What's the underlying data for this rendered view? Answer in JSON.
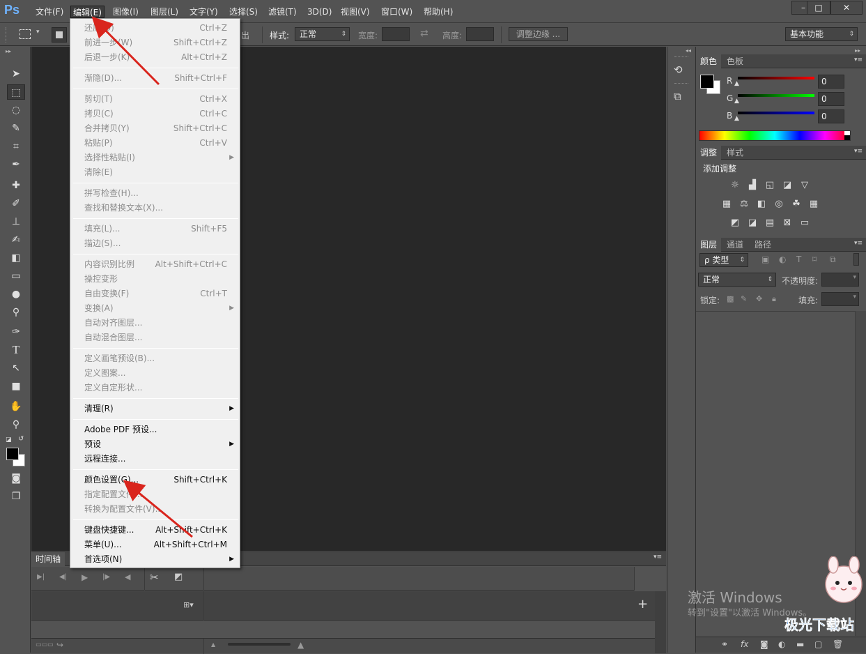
{
  "app": {
    "logo": "Ps"
  },
  "menubar": {
    "items": [
      "文件(F)",
      "编辑(E)",
      "图像(I)",
      "图层(L)",
      "文字(Y)",
      "选择(S)",
      "滤镜(T)",
      "3D(D)",
      "视图(V)",
      "窗口(W)",
      "帮助(H)"
    ],
    "window_buttons": [
      "–",
      "□",
      "✕"
    ]
  },
  "options": {
    "partial_label": "出",
    "style_label": "样式:",
    "style_value": "正常",
    "width_label": "宽度:",
    "height_label": "高度:",
    "refine_label": "调整边缘 ...",
    "workspace_value": "基本功能"
  },
  "edit_menu": {
    "items": [
      {
        "label": "还原(O)",
        "shortcut": "Ctrl+Z",
        "state": "disabled"
      },
      {
        "label": "前进一步(W)",
        "shortcut": "Shift+Ctrl+Z",
        "state": "disabled"
      },
      {
        "label": "后退一步(K)",
        "shortcut": "Alt+Ctrl+Z",
        "state": "disabled"
      },
      {
        "sep": true
      },
      {
        "label": "渐隐(D)...",
        "shortcut": "Shift+Ctrl+F",
        "state": "disabled"
      },
      {
        "sep": true
      },
      {
        "label": "剪切(T)",
        "shortcut": "Ctrl+X",
        "state": "disabled"
      },
      {
        "label": "拷贝(C)",
        "shortcut": "Ctrl+C",
        "state": "disabled"
      },
      {
        "label": "合并拷贝(Y)",
        "shortcut": "Shift+Ctrl+C",
        "state": "disabled"
      },
      {
        "label": "粘贴(P)",
        "shortcut": "Ctrl+V",
        "state": "disabled"
      },
      {
        "label": "选择性粘贴(I)",
        "shortcut": "",
        "submenu": true,
        "state": "disabled"
      },
      {
        "label": "清除(E)",
        "shortcut": "",
        "state": "disabled"
      },
      {
        "sep": true
      },
      {
        "label": "拼写检查(H)...",
        "shortcut": "",
        "state": "disabled"
      },
      {
        "label": "查找和替换文本(X)...",
        "shortcut": "",
        "state": "disabled"
      },
      {
        "sep": true
      },
      {
        "label": "填充(L)...",
        "shortcut": "Shift+F5",
        "state": "disabled"
      },
      {
        "label": "描边(S)...",
        "shortcut": "",
        "state": "disabled"
      },
      {
        "sep": true
      },
      {
        "label": "内容识别比例",
        "shortcut": "Alt+Shift+Ctrl+C",
        "state": "disabled"
      },
      {
        "label": "操控变形",
        "shortcut": "",
        "state": "disabled"
      },
      {
        "label": "自由变换(F)",
        "shortcut": "Ctrl+T",
        "state": "disabled"
      },
      {
        "label": "变换(A)",
        "shortcut": "",
        "submenu": true,
        "state": "disabled"
      },
      {
        "label": "自动对齐图层...",
        "shortcut": "",
        "state": "disabled"
      },
      {
        "label": "自动混合图层...",
        "shortcut": "",
        "state": "disabled"
      },
      {
        "sep": true
      },
      {
        "label": "定义画笔预设(B)...",
        "shortcut": "",
        "state": "disabled"
      },
      {
        "label": "定义图案...",
        "shortcut": "",
        "state": "disabled"
      },
      {
        "label": "定义自定形状...",
        "shortcut": "",
        "state": "disabled"
      },
      {
        "sep": true
      },
      {
        "label": "清理(R)",
        "shortcut": "",
        "submenu": true,
        "state": "enabled"
      },
      {
        "sep": true
      },
      {
        "label": "Adobe PDF 预设...",
        "shortcut": "",
        "state": "enabled"
      },
      {
        "label": "预设",
        "shortcut": "",
        "submenu": true,
        "state": "enabled"
      },
      {
        "label": "远程连接...",
        "shortcut": "",
        "state": "enabled"
      },
      {
        "sep": true
      },
      {
        "label": "颜色设置(G)...",
        "shortcut": "Shift+Ctrl+K",
        "state": "enabled"
      },
      {
        "label": "指定配置文件...",
        "shortcut": "",
        "state": "disabled"
      },
      {
        "label": "转换为配置文件(V)...",
        "shortcut": "",
        "state": "disabled"
      },
      {
        "sep": true
      },
      {
        "label": "键盘快捷键...",
        "shortcut": "Alt+Shift+Ctrl+K",
        "state": "enabled"
      },
      {
        "label": "菜单(U)...",
        "shortcut": "Alt+Shift+Ctrl+M",
        "state": "enabled"
      },
      {
        "label": "首选项(N)",
        "shortcut": "",
        "submenu": true,
        "state": "enabled"
      }
    ]
  },
  "timeline": {
    "tab": "时间轴"
  },
  "color_panel": {
    "tabs": [
      "颜色",
      "色板"
    ],
    "channels": [
      {
        "name": "R",
        "value": "0"
      },
      {
        "name": "G",
        "value": "0"
      },
      {
        "name": "B",
        "value": "0"
      }
    ]
  },
  "adjust_panel": {
    "tabs": [
      "调整",
      "样式"
    ],
    "heading": "添加调整"
  },
  "layers_panel": {
    "tabs": [
      "图层",
      "通道",
      "路径"
    ],
    "filter_label": "ρ 类型",
    "blend_mode": "正常",
    "opacity_label": "不透明度:",
    "lock_label": "锁定:",
    "fill_label": "填充:"
  },
  "watermark": {
    "line1": "激活 Windows",
    "line2": "转到\"设置\"以激活 Windows。",
    "brand": "极光下载站"
  },
  "colors": {
    "canvas": "#282828",
    "ui": "#535353",
    "menu_bg": "#f0f0f0",
    "arrow": "#d9251d"
  }
}
